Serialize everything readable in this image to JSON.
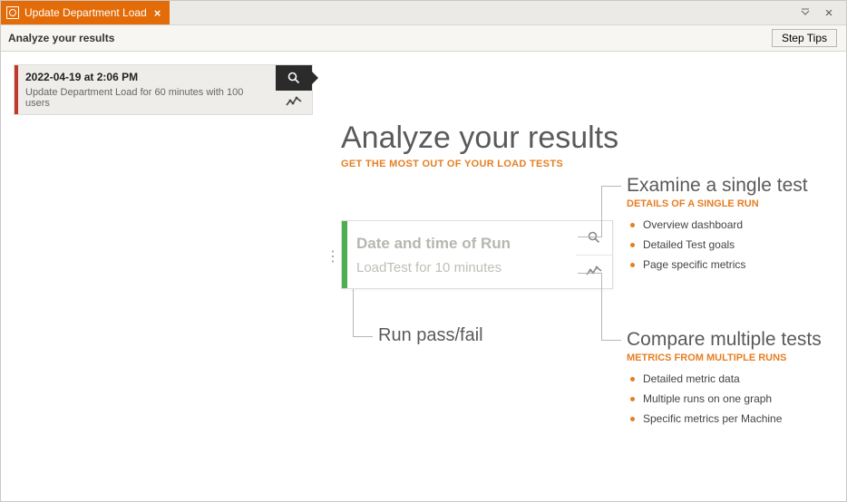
{
  "tab": {
    "title": "Update Department Load"
  },
  "subheader": {
    "title": "Analyze your results",
    "step_tips": "Step Tips"
  },
  "run_card": {
    "date": "2022-04-19 at 2:06 PM",
    "desc": "Update Department Load for 60 minutes with 100 users"
  },
  "hero": {
    "title": "Analyze your results",
    "subtitle": "GET THE MOST OUT OF YOUR LOAD TESTS"
  },
  "example_card": {
    "line1": "Date and time of Run",
    "line2": "LoadTest for 10 minutes"
  },
  "runpass": {
    "title": "Run pass/fail"
  },
  "examine": {
    "title": "Examine a single test",
    "subtitle": "DETAILS OF A SINGLE RUN",
    "items": [
      "Overview dashboard",
      "Detailed Test goals",
      "Page specific metrics"
    ]
  },
  "compare": {
    "title": "Compare multiple tests",
    "subtitle": "METRICS FROM MULTIPLE RUNS",
    "items": [
      "Detailed metric data",
      "Multiple runs on one graph",
      "Specific metrics per Machine"
    ]
  }
}
